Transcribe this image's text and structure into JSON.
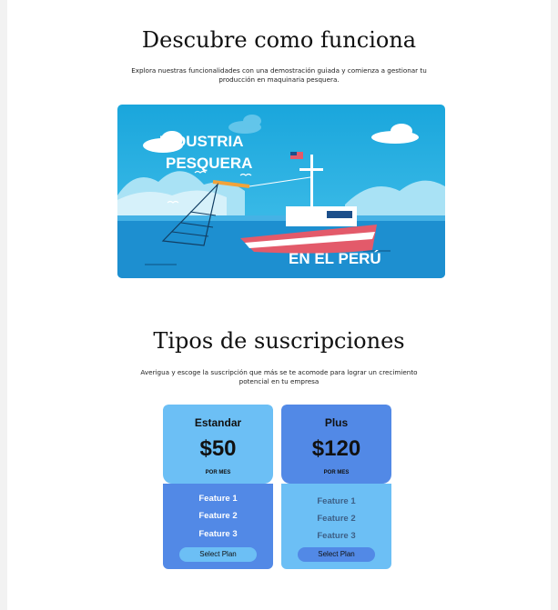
{
  "demo": {
    "title": "Descubre como funciona",
    "description": "Explora nuestras funcionalidades con una demostración guiada y comienza a gestionar tu producción en maquinaria pesquera.",
    "banner": {
      "line1": "INDUSTRIA",
      "line2": "PESQUERA",
      "line3": "EN EL PERÚ"
    }
  },
  "subscriptions": {
    "title": "Tipos de suscripciones",
    "description": "Averigua y escoge la suscripción que más se te acomode para lograr un crecimiento potencial en tu empresa",
    "plans": [
      {
        "name": "Estandar",
        "price": "$50",
        "period": "POR MES",
        "features": [
          "Feature 1",
          "Feature 2",
          "Feature 3"
        ],
        "button": "Select Plan"
      },
      {
        "name": "Plus",
        "price": "$120",
        "period": "POR MES",
        "features": [
          "Feature 1",
          "Feature 2",
          "Feature 3"
        ],
        "button": "Select Plan"
      }
    ]
  },
  "colors": {
    "light_blue": "#6cbff5",
    "mid_blue": "#5289e6",
    "sea": "#1fa2d8"
  }
}
